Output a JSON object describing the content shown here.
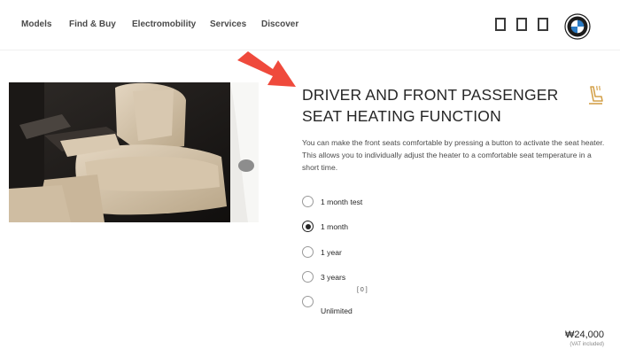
{
  "nav": {
    "items": [
      {
        "label": "Models"
      },
      {
        "label": "Find & Buy"
      },
      {
        "label": "Electromobility"
      },
      {
        "label": "Services"
      },
      {
        "label": "Discover"
      }
    ]
  },
  "feature": {
    "title": "DRIVER AND FRONT PASSENGER SEAT HEATING FUNCTION",
    "description": "You can make the front seats comfortable by pressing a button to activate the seat heater. This allows you to individually adjust the heater to a comfortable seat temperature in a short time.",
    "options": [
      {
        "label": "1 month test",
        "selected": false
      },
      {
        "label": "1 month",
        "selected": true
      },
      {
        "label": "1 year",
        "selected": false
      },
      {
        "label": "3 years",
        "selected": false
      },
      {
        "label": "Unlimited",
        "selected": false,
        "count": "[ 0 ]"
      }
    ]
  },
  "price": {
    "amount": "₩24,000",
    "note": "(VAT included)"
  },
  "colors": {
    "accent_arrow": "#ef4a3c",
    "seat_icon": "#d4a24c",
    "text": "#262626"
  }
}
